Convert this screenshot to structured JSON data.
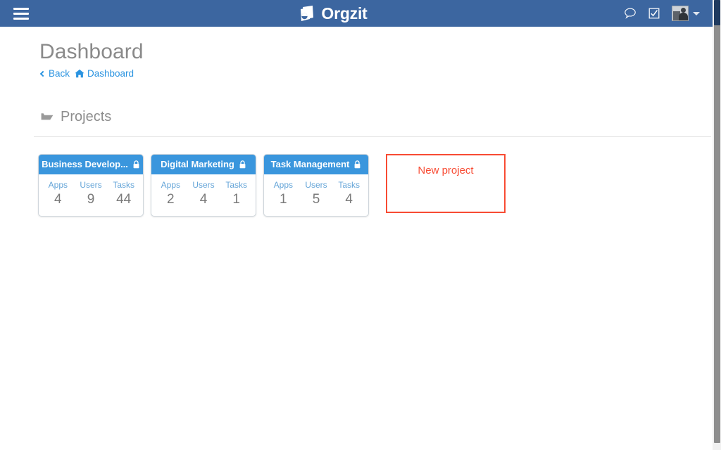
{
  "navbar": {
    "menu_icon": "hamburger-menu-icon",
    "brand": {
      "logo_icon": "orgzit-logo-icon",
      "name": "Orgzit"
    },
    "actions": [
      {
        "icon": "chat-bubble-icon",
        "label": "Chat"
      },
      {
        "icon": "checkbox-checked-icon",
        "label": "Tasks"
      }
    ],
    "user": {
      "avatar_icon": "user-avatar-icon",
      "caret_icon": "chevron-down-icon"
    },
    "colors": {
      "background": "#3c66a0",
      "text": "#ffffff"
    }
  },
  "header": {
    "title": "Dashboard",
    "breadcrumb": {
      "back_label": "Back",
      "back_icon": "chevron-left-icon",
      "home_icon": "home-icon",
      "current_label": "Dashboard",
      "link_color": "#2a93e0"
    }
  },
  "projects_section": {
    "icon": "folder-open-icon",
    "title": "Projects",
    "stat_labels": [
      "Apps",
      "Users",
      "Tasks"
    ],
    "lock_icon": "lock-icon",
    "header_color": "#3a96dd",
    "cards": [
      {
        "name": "Business Develop...",
        "locked": true,
        "apps": "4",
        "users": "9",
        "tasks": "44"
      },
      {
        "name": "Digital Marketing",
        "locked": true,
        "apps": "2",
        "users": "4",
        "tasks": "1"
      },
      {
        "name": "Task Management",
        "locked": true,
        "apps": "1",
        "users": "5",
        "tasks": "4"
      }
    ],
    "new_project": {
      "label": "New project",
      "color": "#f84b33"
    }
  }
}
